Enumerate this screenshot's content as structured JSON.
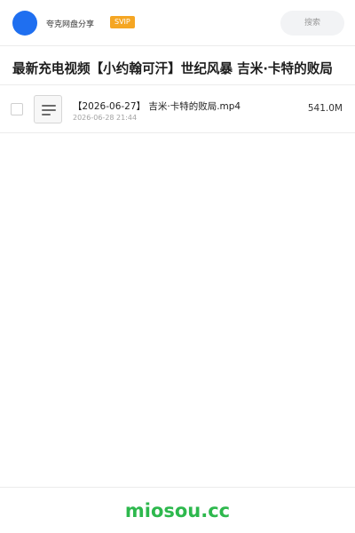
{
  "header": {
    "user_name": "夸克网盘分享",
    "badge": "SVIP",
    "search_placeholder": "搜索"
  },
  "share": {
    "title": "最新充电视频【小约翰可汗】世纪风暴 吉米·卡特的败局"
  },
  "files": [
    {
      "name": "【2026-06-27】 吉米·卡特的败局.mp4",
      "date": "2026-06-28 21:44",
      "size": "541.0M",
      "icon": "video-file-icon"
    }
  ],
  "footer": {
    "watermark": "miosou.cc"
  },
  "colors": {
    "avatar": "#1f6ff0",
    "svip_badge": "#f5a623",
    "watermark": "#2db84d"
  }
}
